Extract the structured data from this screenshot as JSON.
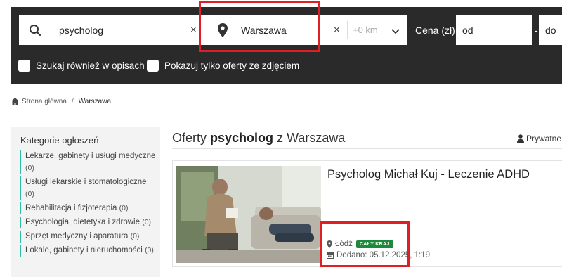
{
  "search": {
    "query": "psycholog",
    "location": "Warszawa",
    "radius": "+0 km",
    "price_label": "Cena (zł):",
    "price_from_placeholder": "od",
    "price_to_placeholder": "do",
    "separator": "-",
    "clear_symbol": "×",
    "option_descriptions": "Szukaj również w opisach",
    "option_photos": "Pokazuj tylko oferty ze zdjęciem"
  },
  "breadcrumb": {
    "home": "Strona główna",
    "separator": "/",
    "current": "Warszawa"
  },
  "sidebar": {
    "title": "Kategorie ogłoszeń",
    "categories": [
      {
        "label": "Lekarze, gabinety i usługi medyczne",
        "count": "(0)"
      },
      {
        "label": "Usługi lekarskie i stomatologiczne",
        "count": "(0)"
      },
      {
        "label": "Rehabilitacja i fizjoterapia",
        "count": "(0)"
      },
      {
        "label": "Psychologia, dietetyka i zdrowie",
        "count": "(0)"
      },
      {
        "label": "Sprzęt medyczny i aparatura",
        "count": "(0)"
      },
      {
        "label": "Lokale, gabinety i nieruchomości",
        "count": "(0)"
      }
    ]
  },
  "main": {
    "title_prefix": "Oferty",
    "title_query": "psycholog",
    "title_mid": "z",
    "title_location": "Warszawa",
    "sort_label": "Prywatne"
  },
  "listing": {
    "title": "Psycholog Michał Kuj - Leczenie ADHD",
    "location": "Łódź",
    "badge": "CAŁY KRAJ",
    "added": "Dodano: 05.12.2025, 1:19"
  },
  "colors": {
    "search_bg": "#2a2a2a",
    "highlight": "#e01e26",
    "accent": "#2bbfa4",
    "badge": "#1c8a3a"
  }
}
